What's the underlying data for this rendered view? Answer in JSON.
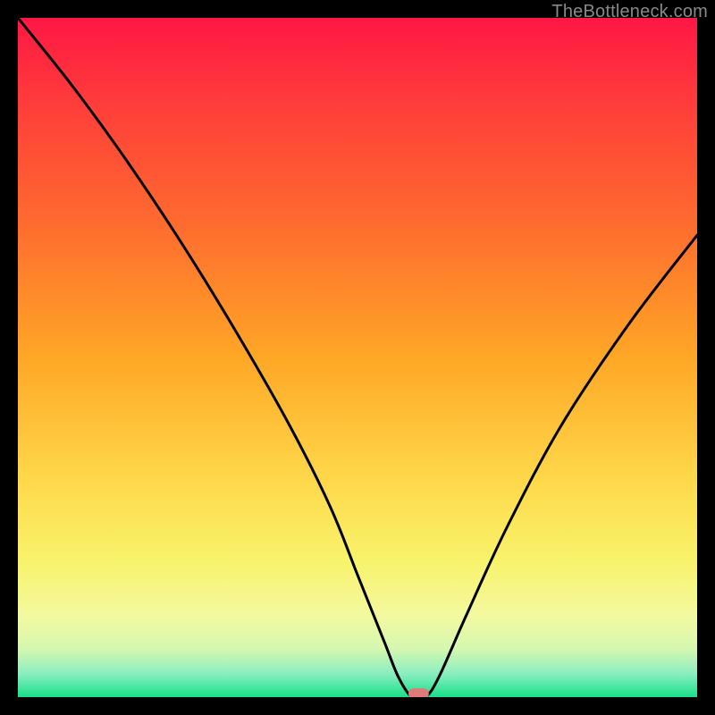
{
  "watermark": "TheBottleneck.com",
  "chart_data": {
    "type": "line",
    "title": "",
    "xlabel": "",
    "ylabel": "",
    "xlim": [
      0,
      100
    ],
    "ylim": [
      0,
      100
    ],
    "series": [
      {
        "name": "bottleneck-curve",
        "x": [
          0,
          8,
          16,
          24,
          32,
          40,
          46,
          50,
          54,
          56,
          58,
          60,
          62,
          66,
          72,
          80,
          90,
          100
        ],
        "values": [
          100,
          90,
          79,
          67,
          54,
          40,
          28,
          18,
          8,
          3,
          0,
          0,
          3,
          12,
          25,
          40,
          55,
          68
        ]
      }
    ],
    "marker": {
      "x": 59,
      "y": 0.5,
      "color": "#e07a7a",
      "width_pct": 3.0,
      "height_pct": 1.6
    },
    "gradient_stops": [
      {
        "offset": 0.0,
        "color": "#ff1744"
      },
      {
        "offset": 0.12,
        "color": "#ff3b3b"
      },
      {
        "offset": 0.3,
        "color": "#ff6a2f"
      },
      {
        "offset": 0.5,
        "color": "#ffa726"
      },
      {
        "offset": 0.68,
        "color": "#ffd84a"
      },
      {
        "offset": 0.8,
        "color": "#f8f36b"
      },
      {
        "offset": 0.88,
        "color": "#f3f9a0"
      },
      {
        "offset": 0.93,
        "color": "#d4f7b0"
      },
      {
        "offset": 0.965,
        "color": "#8ceec0"
      },
      {
        "offset": 1.0,
        "color": "#18e08a"
      }
    ]
  }
}
